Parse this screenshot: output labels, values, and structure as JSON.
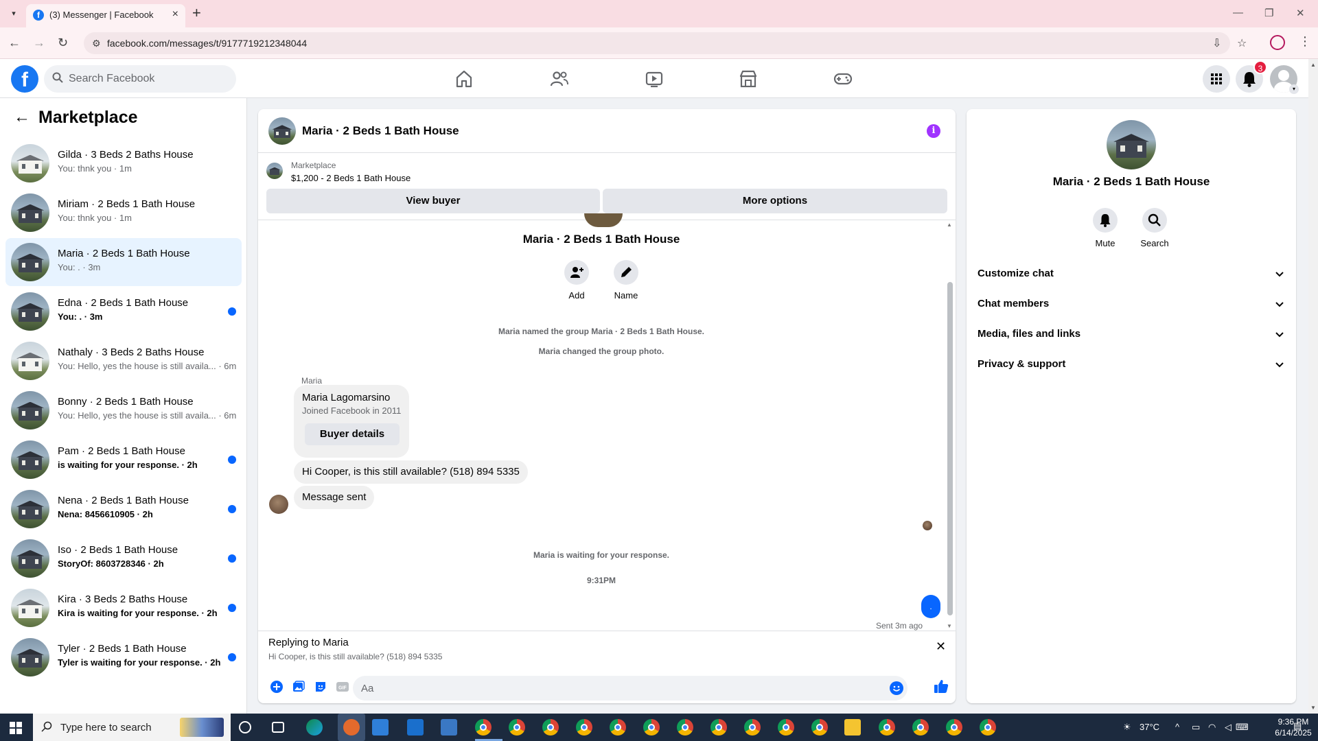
{
  "browser": {
    "tab_title": "(3) Messenger | Facebook",
    "url": "facebook.com/messages/t/9177719212348044"
  },
  "fb": {
    "search_placeholder": "Search Facebook",
    "notification_count": "3"
  },
  "sidebar": {
    "title": "Marketplace",
    "conversations": [
      {
        "name": "Gilda · 3 Beds 2 Baths House",
        "preview": "You: thnk you · 1m",
        "unread": false,
        "house": "white"
      },
      {
        "name": "Miriam · 2 Beds 1 Bath House",
        "preview": "You: thnk you · 1m",
        "unread": false,
        "house": "dark"
      },
      {
        "name": "Maria · 2 Beds 1 Bath House",
        "preview": "You: . · 3m",
        "unread": false,
        "house": "dark"
      },
      {
        "name": "Edna · 2 Beds 1 Bath House",
        "preview": "You: . · 3m",
        "unread": true,
        "house": "dark"
      },
      {
        "name": "Nathaly · 3 Beds 2 Baths House",
        "preview": "You: Hello, yes the house is still availa... · 6m",
        "unread": false,
        "house": "white"
      },
      {
        "name": "Bonny · 2 Beds 1 Bath House",
        "preview": "You: Hello, yes the house is still availa... · 6m",
        "unread": false,
        "house": "dark"
      },
      {
        "name": "Pam · 2 Beds 1 Bath House",
        "preview": "is waiting for your response. · 2h",
        "unread": true,
        "house": "dark"
      },
      {
        "name": "Nena · 2 Beds 1 Bath House",
        "preview": "Nena: 8456610905 · 2h",
        "unread": true,
        "house": "dark"
      },
      {
        "name": "Iso · 2 Beds 1 Bath House",
        "preview": "StoryOf: 8603728346 · 2h",
        "unread": true,
        "house": "dark"
      },
      {
        "name": "Kira · 3 Beds 2 Baths House",
        "preview": "Kira is waiting for your response. · 2h",
        "unread": true,
        "house": "white"
      },
      {
        "name": "Tyler · 2 Beds 1 Bath House",
        "preview": "Tyler is waiting for your response. · 2h",
        "unread": true,
        "house": "dark"
      }
    ]
  },
  "chat": {
    "title": "Maria · 2 Beds 1 Bath House",
    "marketplace_label": "Marketplace",
    "listing": "$1,200 - 2 Beds 1 Bath House",
    "view_buyer": "View buyer",
    "more_options": "More options",
    "group_name": "Maria · 2 Beds 1 Bath House",
    "add_label": "Add",
    "name_label": "Name",
    "sys1": "Maria named the group Maria · 2 Beds 1 Bath House.",
    "sys2": "Maria changed the group photo.",
    "sender": "Maria",
    "card_name": "Maria Lagomarsino",
    "card_joined": "Joined Facebook in 2011",
    "buyer_details": "Buyer details",
    "msg1": "Hi Cooper, is this still available? (518) 894 5335",
    "msg2": "Message sent",
    "waiting": "Maria is waiting for your response.",
    "time": "9:31PM",
    "my_msg": ".",
    "sent_status": "Sent 3m ago",
    "reply_title": "Replying to Maria",
    "reply_quote": "Hi Cooper, is this still available? (518) 894 5335",
    "composer_placeholder": "Aa"
  },
  "details": {
    "name": "Maria · 2 Beds 1 Bath House",
    "mute": "Mute",
    "search": "Search",
    "sections": [
      "Customize chat",
      "Chat members",
      "Media, files and links",
      "Privacy & support"
    ]
  },
  "taskbar": {
    "search_placeholder": "Type here to search",
    "temp": "37°C",
    "time": "9:36 PM",
    "date": "6/14/2025"
  },
  "colors": {
    "fb_blue": "#1877f2",
    "messenger_blue": "#0866ff",
    "info_purple": "#a033ff",
    "badge_red": "#e41e3f"
  }
}
